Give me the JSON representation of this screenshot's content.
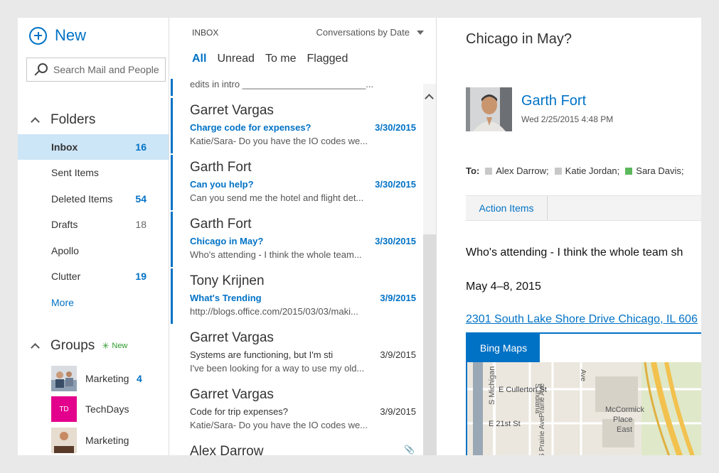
{
  "nav": {
    "new_label": "New",
    "search_placeholder": "Search Mail and People",
    "folders_label": "Folders",
    "folders": [
      {
        "label": "Inbox",
        "count": "16"
      },
      {
        "label": "Sent Items",
        "count": ""
      },
      {
        "label": "Deleted Items",
        "count": "54"
      },
      {
        "label": "Drafts",
        "count": "18"
      },
      {
        "label": "Apollo",
        "count": ""
      },
      {
        "label": "Clutter",
        "count": "19"
      }
    ],
    "more_label": "More",
    "groups_label": "Groups",
    "groups_new_badge": "New",
    "groups": [
      {
        "label": "Marketing",
        "count": "4"
      },
      {
        "label": "TechDays",
        "count": "",
        "avatar_text": "TD"
      },
      {
        "label": "Marketing",
        "count": ""
      }
    ]
  },
  "list": {
    "title": "INBOX",
    "sort_label": "Conversations by Date",
    "filters": [
      "All",
      "Unread",
      "To me",
      "Flagged"
    ],
    "partial_preview": "edits in intro ________________________...",
    "messages": [
      {
        "sender": "Garret Vargas",
        "subject": "Charge code for expenses?",
        "date": "3/30/2015",
        "preview": "Katie/Sara- Do you have the IO codes we...",
        "unread": true
      },
      {
        "sender": "Garth Fort",
        "subject": "Can you help?",
        "date": "3/30/2015",
        "preview": "Can you send me the hotel and flight det...",
        "unread": true
      },
      {
        "sender": "Garth Fort",
        "subject": "Chicago in May?",
        "date": "3/30/2015",
        "preview": "Who's attending - I think the whole team...",
        "unread": true
      },
      {
        "sender": "Tony Krijnen",
        "subject": "What's Trending",
        "date": "3/9/2015",
        "preview": "http://blogs.office.com/2015/03/03/maki...",
        "unread": true
      },
      {
        "sender": "Garret Vargas",
        "subject": "Systems are functioning, but I'm sti",
        "date": "3/9/2015",
        "preview": "I've been looking for a way to use my old...",
        "unread": false
      },
      {
        "sender": "Garret Vargas",
        "subject": "Code for trip expenses?",
        "date": "3/9/2015",
        "preview": "Katie/Sara- Do you have the IO codes we...",
        "unread": false
      },
      {
        "sender": "Alex Darrow",
        "subject": "",
        "date": "",
        "preview": "",
        "unread": false
      }
    ]
  },
  "reading": {
    "subject": "Chicago in May?",
    "sender": "Garth Fort",
    "sent": "Wed 2/25/2015 4:48 PM",
    "to_label": "To:",
    "recipients": [
      {
        "name": "Alex Darrow;",
        "color": "#c8c8c8"
      },
      {
        "name": "Katie Jordan;",
        "color": "#c8c8c8"
      },
      {
        "name": "Sara Davis;",
        "color": "#5cb85c"
      }
    ],
    "action_items_label": "Action Items",
    "body_line1": "Who's attending - I think the whole team sh",
    "body_line2": "May 4–8, 2015",
    "address": "2301 South Lake Shore Drive Chicago, IL 606",
    "map_tab": "Bing Maps",
    "map_labels": {
      "cullerton": "E Cullerton St",
      "twentyfirst": "E 21st St",
      "michigan": "S Michigan",
      "indiana": "S Indiana",
      "prairie1": "Prairie Ave",
      "prairie2": "S Prairie Ave",
      "ave": "Ave",
      "mccormick": "McCormick",
      "place": "Place",
      "east": "East"
    }
  },
  "colors": {
    "accent": "#0072c6",
    "selected_folder_bg": "#cde6f7",
    "td_avatar": "#e3008c",
    "new_badge": "#2b9a2b"
  }
}
